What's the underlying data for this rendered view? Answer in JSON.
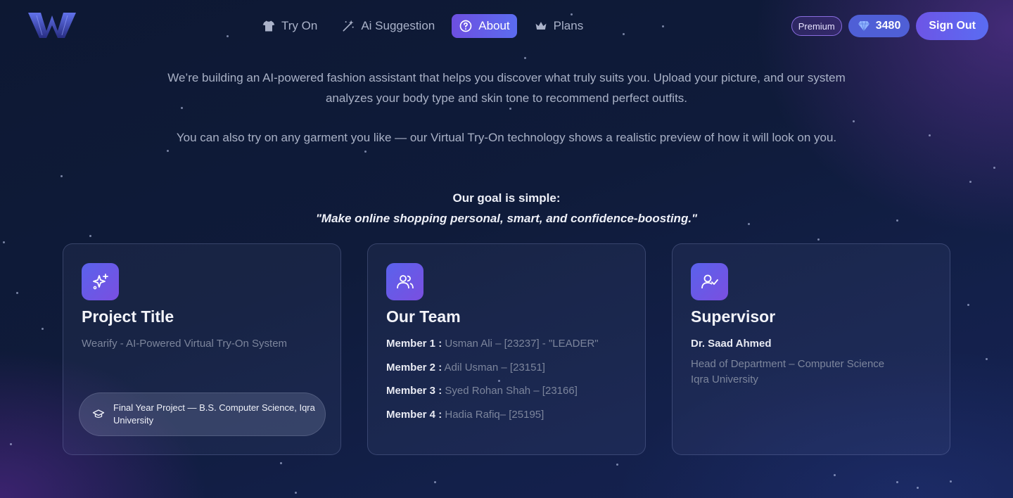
{
  "nav": {
    "items": [
      {
        "label": "Try On",
        "icon": "shirt-icon"
      },
      {
        "label": "Ai Suggestion",
        "icon": "magic-wand-icon"
      },
      {
        "label": "About",
        "icon": "question-circle-icon",
        "active": true
      },
      {
        "label": "Plans",
        "icon": "crown-icon"
      }
    ]
  },
  "header": {
    "premium_badge": "Premium",
    "credits": "3480",
    "credits_icon": "gem-icon",
    "sign_out": "Sign Out"
  },
  "intro": {
    "paragraph1": "We’re building an AI-powered fashion assistant that helps you discover what truly suits you. Upload your picture, and our system analyzes your body type and skin tone to recommend perfect outfits.",
    "paragraph2": "You can also try on any garment you like — our Virtual Try-On technology shows a realistic preview of how it will look on you.",
    "goal_heading": "Our goal is simple:",
    "goal_quote": "\"Make online shopping personal, smart, and confidence-boosting.\""
  },
  "cards": {
    "project": {
      "icon": "sparkles-icon",
      "title": "Project Title",
      "text": "Wearify - AI-Powered Virtual Try-On System",
      "footer_icon": "graduation-cap-icon",
      "footer": "Final Year Project — B.S. Computer Science, Iqra University"
    },
    "team": {
      "icon": "users-icon",
      "title": "Our Team",
      "members": [
        {
          "label": "Member 1 :",
          "value": "Usman Ali – [23237] - \"LEADER\""
        },
        {
          "label": "Member 2 :",
          "value": "Adil Usman – [23151]"
        },
        {
          "label": "Member 3 :",
          "value": "Syed Rohan Shah – [23166]"
        },
        {
          "label": "Member 4 :",
          "value": "Hadia Rafiq– [25195]"
        }
      ]
    },
    "supervisor": {
      "icon": "user-check-icon",
      "title": "Supervisor",
      "name": "Dr. Saad Ahmed",
      "role_line1": "Head of Department – Computer Science",
      "role_line2": "Iqra University"
    }
  },
  "colors": {
    "accent": "#6d55e6",
    "accent_blue": "#5a6cf2",
    "background": "#0f1b3a",
    "muted_text": "#7c859c"
  }
}
